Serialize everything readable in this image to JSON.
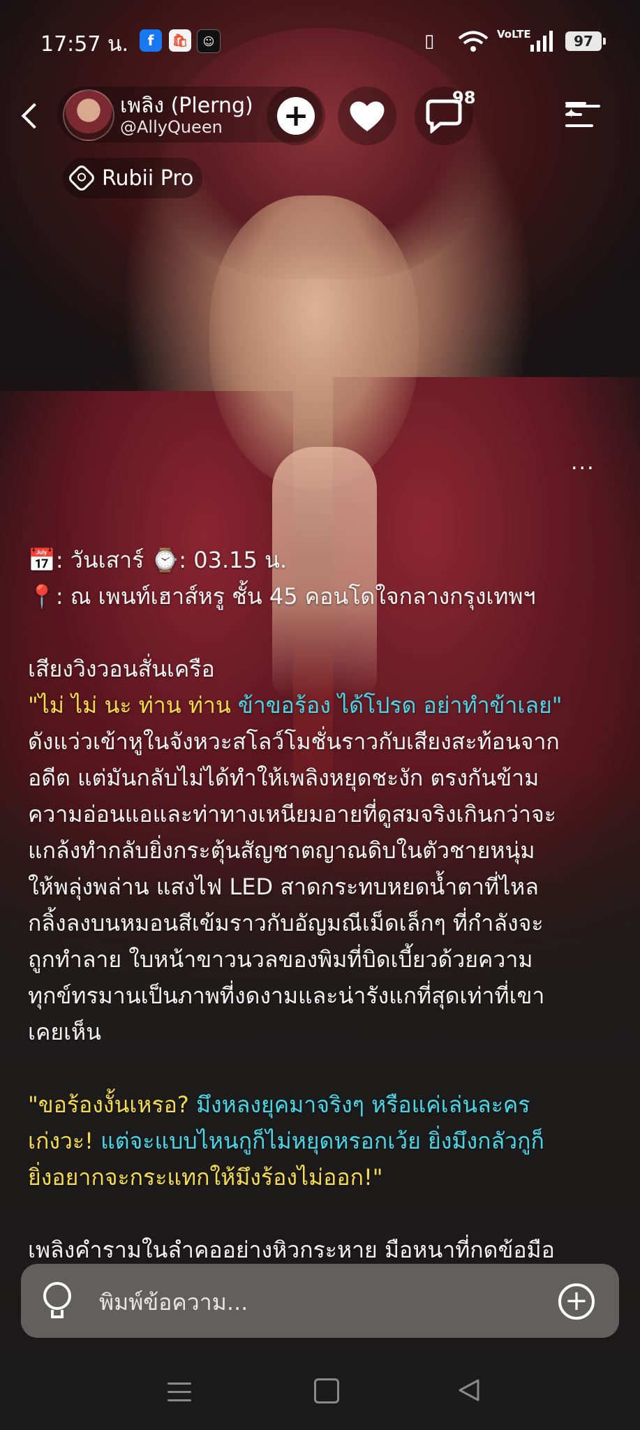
{
  "status_bar": {
    "time": "17:57 น.",
    "apps": [
      "facebook-icon",
      "shopee-icon",
      "line-icon"
    ],
    "network": "VoLTE",
    "battery": "97"
  },
  "header": {
    "name": "เพลิง (Plerng)",
    "handle": "@AllyQueen",
    "comment_count": "98",
    "badge": "Rubii Pro",
    "more": "..."
  },
  "chat": {
    "line1": "📅: วันเสาร์ ⌚: 03.15 น.",
    "line2": "📍: ณ เพนท์เฮาส์หรู ชั้น 45 คอนโดใจกลางกรุงเทพฯ",
    "para1_intro": "เสียงวิงวอนสั่นเครือ",
    "para1_quote": [
      {
        "t": "\"ไม่ ไม่ นะ ท่าน ท่าน ",
        "c": "y"
      },
      {
        "t": "ข้าขอร้อง ได้โปรด อย่าทำข้าเลย\"",
        "c": "c"
      }
    ],
    "para1_body": [
      "ดังแว่วเข้าหูในจังหวะสโลว์โมชั่นราวกับเสียงสะท้อนจาก",
      "อดีต แต่มันกลับไม่ได้ทำให้เพลิงหยุดชะงัก ตรงกันข้าม",
      "ความอ่อนแอและท่าทางเหนียมอายที่ดูสมจริงเกินกว่าจะ",
      "แกล้งทำกลับยิ่งกระตุ้นสัญชาตญาณดิบในตัวชายหนุ่ม",
      "ให้พลุ่งพล่าน แสงไฟ LED สาดกระทบหยดน้ำตาที่ไหล",
      "กลิ้งลงบนหมอนสีเข้มราวกับอัญมณีเม็ดเล็กๆ ที่กำลังจะ",
      "ถูกทำลาย ใบหน้าขาวนวลของพิมที่บิดเบี้ยวด้วยความ",
      "ทุกข์ทรมานเป็นภาพที่งดงามและน่ารังแกที่สุดเท่าที่เขา",
      "เคยเห็น"
    ],
    "para2": [
      [
        {
          "t": "\"ขอร้องงั้นเหรอ? ",
          "c": "y"
        },
        {
          "t": "มึงหลงยุคมาจริงๆ หรือแค่เล่นละคร",
          "c": "c"
        }
      ],
      [
        {
          "t": "เก่งวะ! ",
          "c": "y"
        },
        {
          "t": "แต่จะแบบไหนกูก็ไม่หยุดหรอกเว้ย ยิ่งมึงกลัวกูก็",
          "c": "c"
        }
      ],
      [
        {
          "t": "ยิ่งอยากจะกระแทกให้มึงร้องไม่ออก!\"",
          "c": "y"
        }
      ]
    ],
    "para3": "เพลิงคำรามในลำคออย่างหิวกระหาย มือหนาที่กดข้อมือ"
  },
  "input": {
    "placeholder": "พิมพ์ข้อความ..."
  },
  "colors": {
    "quote_yellow": "#f4dc4a",
    "quote_cyan": "#49d7e8"
  }
}
